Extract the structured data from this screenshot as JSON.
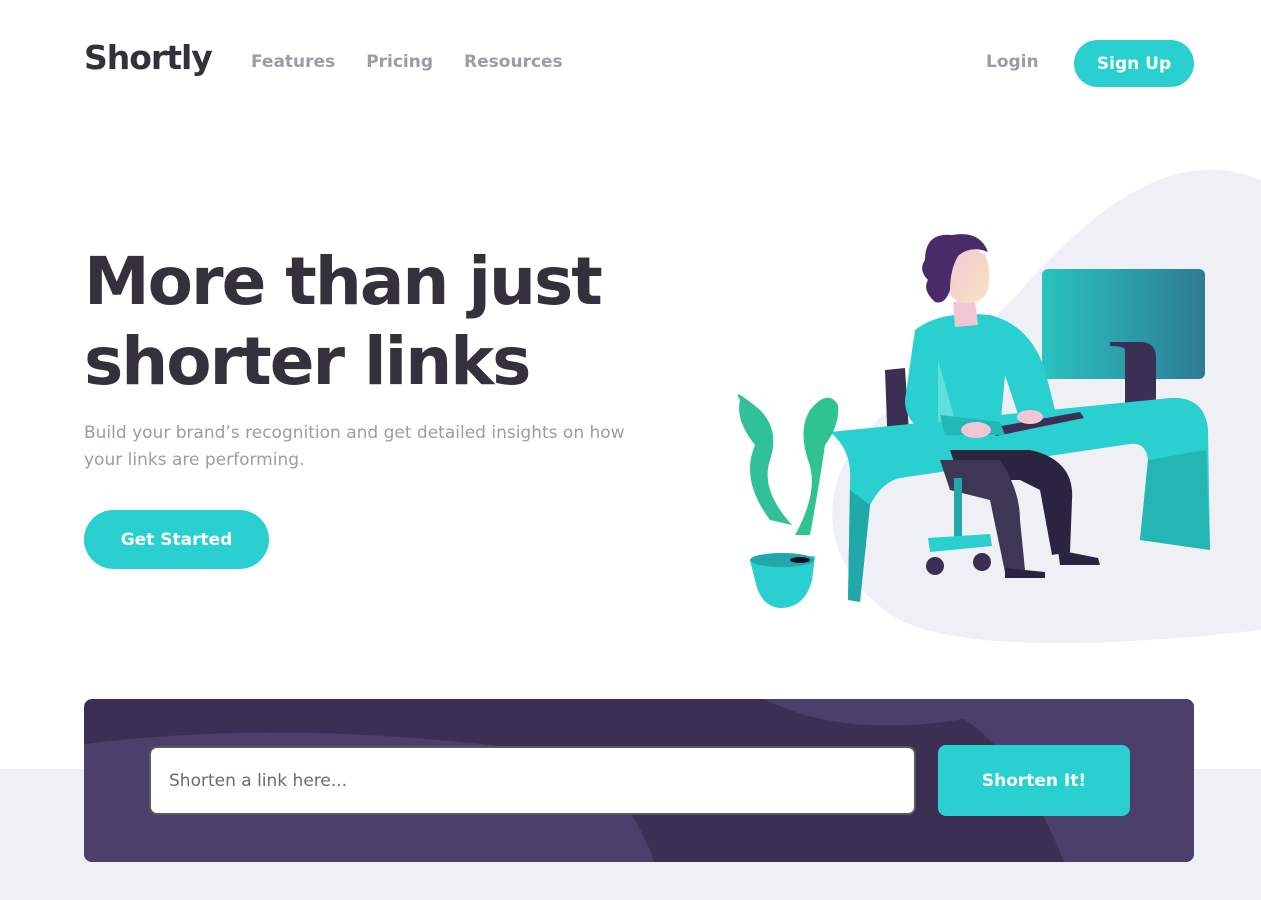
{
  "brand": {
    "logo": "Shortly",
    "accent": "#2acfcf",
    "dark_violet": "#3b3054",
    "grey_text": "#9e9aa8"
  },
  "header": {
    "nav": [
      "Features",
      "Pricing",
      "Resources"
    ],
    "login": "Login",
    "signup": "Sign Up"
  },
  "hero": {
    "title_line1": "More than just",
    "title_line2": "shorter links",
    "subtitle": "Build your brand’s recognition and get detailed insights on how your links are performing.",
    "cta": "Get Started",
    "illustration": "person-working-at-desk-illustration"
  },
  "shorten": {
    "placeholder": "Shorten a link here...",
    "value": "",
    "button": "Shorten It!"
  }
}
